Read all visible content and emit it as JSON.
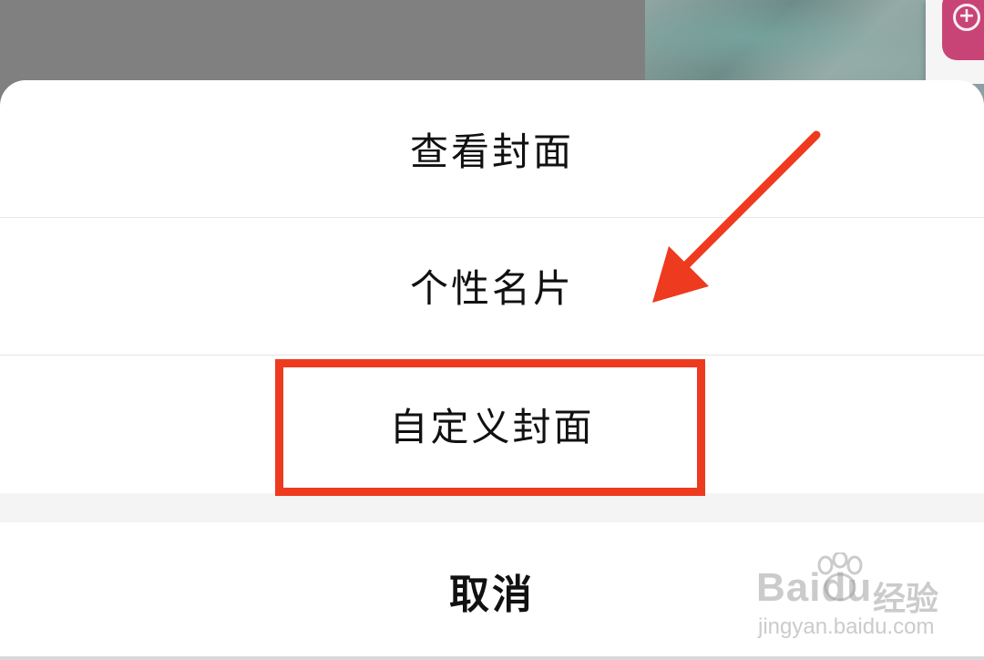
{
  "action_sheet": {
    "options": [
      {
        "label": "查看封面"
      },
      {
        "label": "个性名片"
      },
      {
        "label": "自定义封面"
      }
    ],
    "cancel_label": "取消"
  },
  "annotation": {
    "highlight_color": "#ee3a1f",
    "arrow_color": "#ee3a1f"
  },
  "watermark": {
    "brand": "Baidu",
    "product": "经验",
    "url": "jingyan.baidu.com"
  },
  "colors": {
    "overlay": "#808080",
    "sheet_bg": "#ffffff",
    "divider": "#e6e6e6"
  }
}
